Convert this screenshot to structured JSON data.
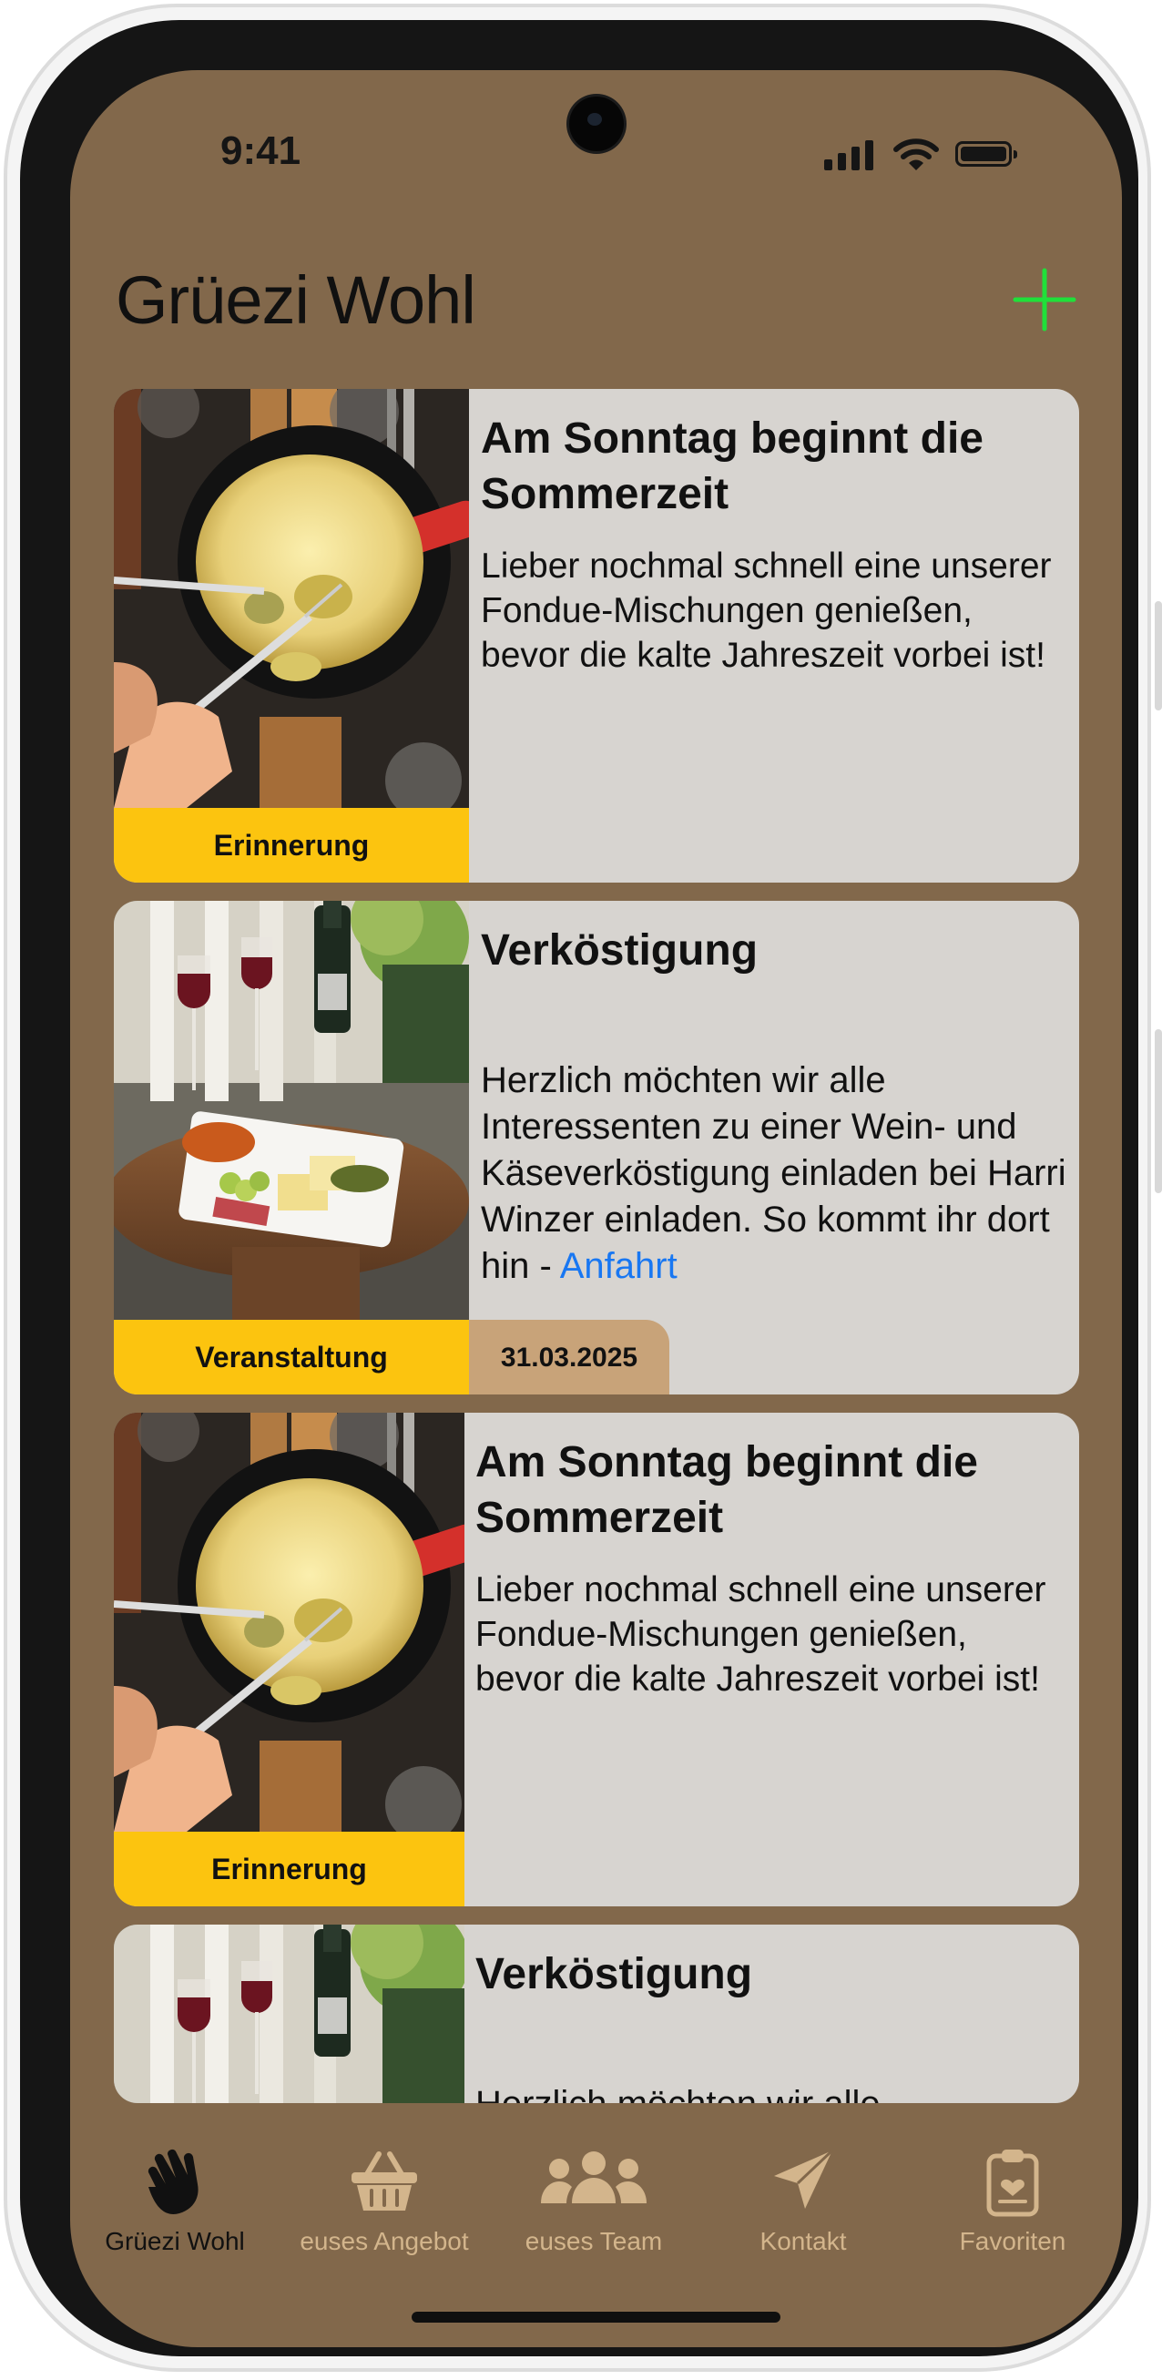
{
  "status_bar": {
    "time": "9:41"
  },
  "header": {
    "title": "Grüezi Wohl",
    "add_icon": "plus-icon"
  },
  "colors": {
    "background": "#82684b",
    "card": "#d7d4d0",
    "tag": "#fcc40f",
    "date_badge": "#c8a379",
    "accent_add": "#20e03a",
    "link": "#1877f2",
    "tab_inactive": "#d3b58c",
    "tab_active": "#111111"
  },
  "cards": [
    {
      "image": "fondue-photo",
      "tag": "Erinnerung",
      "title": "Am Sonntag beginnt die Sommerzeit",
      "body": "Lieber nochmal schnell eine unserer Fondue-Mischungen genießen, bevor die kalte Jahreszeit vorbei ist!"
    },
    {
      "image": "wine-cheese-photo",
      "tag": "Veranstaltung",
      "date": "31.03.2025",
      "title": "Verköstigung",
      "body": "Herzlich möchten wir  alle Interessenten zu einer Wein- und Käseverköstigung einladen bei Harri Winzer einladen. So kommt ihr dort hin - ",
      "link": "Anfahrt"
    },
    {
      "image": "fondue-photo",
      "tag": "Erinnerung",
      "title": "Am Sonntag beginnt die Sommerzeit",
      "body": "Lieber nochmal schnell eine unserer Fondue-Mischungen genießen, bevor die kalte Jahreszeit vorbei ist!"
    },
    {
      "image": "wine-cheese-photo",
      "title": "Verköstigung",
      "body": "Herzlich möchten wir  alle"
    }
  ],
  "tabs": [
    {
      "label": "Grüezi Wohl",
      "icon": "waving-hand-icon",
      "active": true
    },
    {
      "label": "euses Angebot",
      "icon": "basket-icon",
      "active": false
    },
    {
      "label": "euses Team",
      "icon": "team-icon",
      "active": false
    },
    {
      "label": "Kontakt",
      "icon": "paper-plane-icon",
      "active": false
    },
    {
      "label": "Favoriten",
      "icon": "clipboard-heart-icon",
      "active": false
    }
  ]
}
